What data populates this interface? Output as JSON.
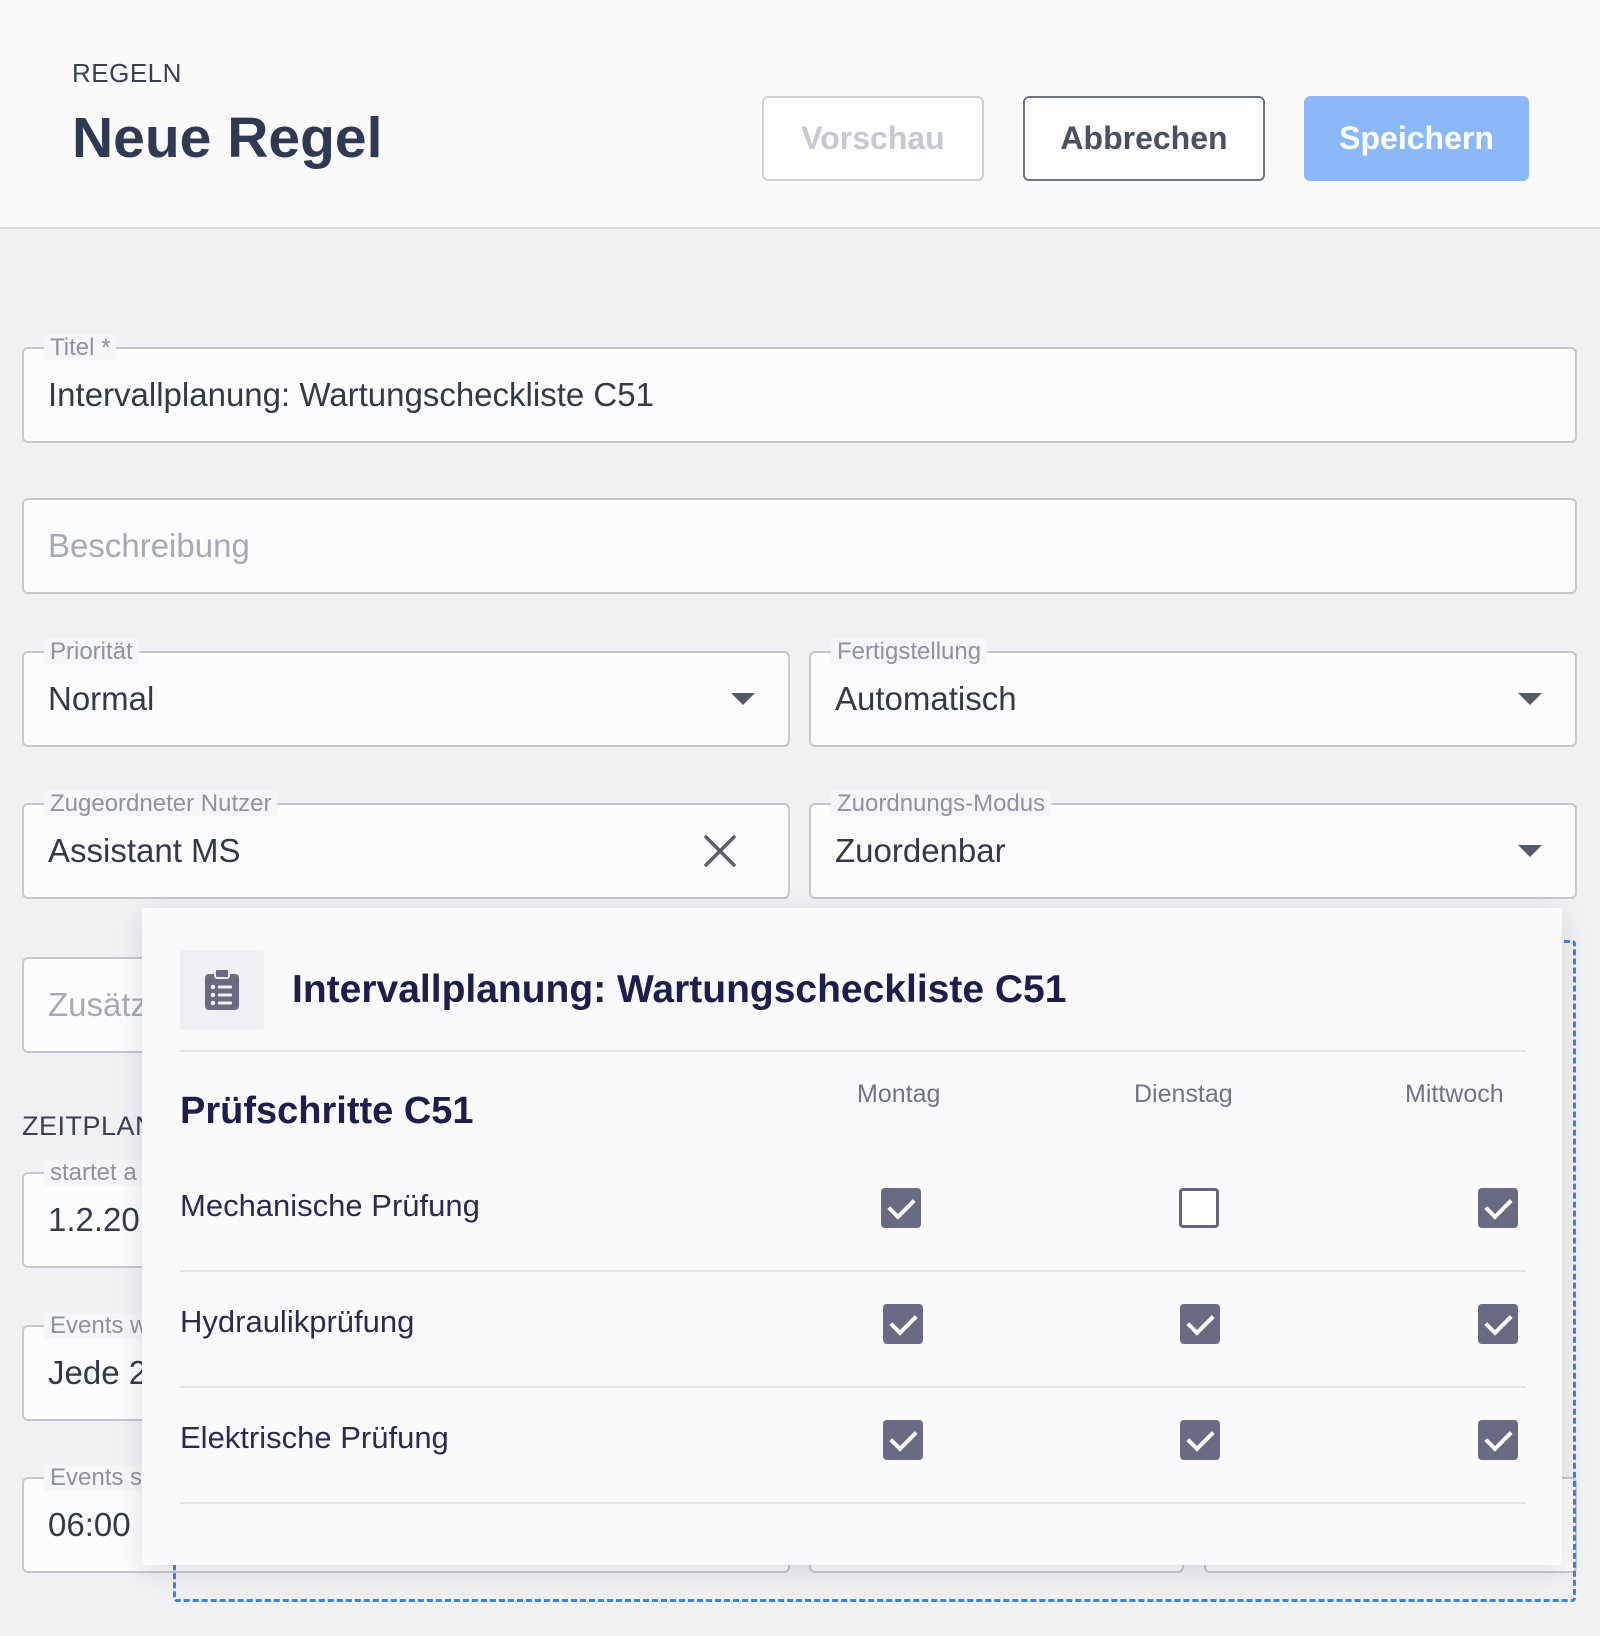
{
  "header": {
    "breadcrumb": "REGELN",
    "title": "Neue Regel",
    "buttons": {
      "preview": "Vorschau",
      "cancel": "Abbrechen",
      "save": "Speichern"
    }
  },
  "form": {
    "title": {
      "label": "Titel *",
      "value": "Intervallplanung: Wartungscheckliste C51"
    },
    "description": {
      "placeholder": "Beschreibung"
    },
    "priority": {
      "label": "Priorität",
      "value": "Normal"
    },
    "completion": {
      "label": "Fertigstellung",
      "value": "Automatisch"
    },
    "assigned_user": {
      "label": "Zugeordneter Nutzer",
      "value": "Assistant MS"
    },
    "assignment_mode": {
      "label": "Zuordnungs-Modus",
      "value": "Zuordenbar"
    },
    "additional": {
      "placeholder": "Zusätz"
    },
    "schedule": {
      "section_label": "ZEITPLAN",
      "starts": {
        "label": "startet a",
        "value": "1.2.20"
      },
      "events_repeat": {
        "label": "Events w",
        "value": "Jede 2"
      },
      "events_start": {
        "label": "Events s",
        "value": "06:00"
      }
    }
  },
  "popup": {
    "title": "Intervallplanung: Wartungscheckliste C51",
    "icon": "clipboard-list-icon",
    "section_title": "Prüfschritte C51",
    "days": [
      "Montag",
      "Dienstag",
      "Mittwoch"
    ],
    "tasks": [
      {
        "name": "Mechanische Prüfung",
        "checks": [
          true,
          false,
          true
        ]
      },
      {
        "name": "Hydraulikprüfung",
        "checks": [
          true,
          true,
          true
        ]
      },
      {
        "name": "Elektrische Prüfung",
        "checks": [
          true,
          true,
          true
        ]
      }
    ]
  },
  "colors": {
    "primary": "#8bb8f7",
    "title": "#2f3a52",
    "popup_text": "#1d1e4b",
    "checkbox": "#696b82",
    "dashed": "#3a82f0"
  }
}
